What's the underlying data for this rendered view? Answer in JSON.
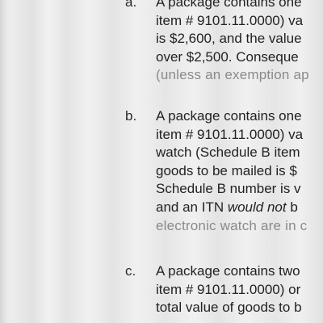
{
  "document": {
    "items": [
      {
        "marker": "a.",
        "lines": [
          "A package contains one",
          "item # 9101.11.0000) va",
          "is $2,600, and the value",
          "over $2,500. Conseque",
          "(unless an exemption ap"
        ]
      },
      {
        "marker": "b.",
        "lines": [
          "A package contains one",
          "item # 9101.11.0000) va",
          "watch (Schedule B item",
          "goods to be mailed is $",
          "Schedule B number is v"
        ],
        "itn_line": {
          "before": "and an ITN ",
          "emphasis": "would not",
          "after": " b"
        },
        "last_line": "electronic watch are in c"
      },
      {
        "marker": "c.",
        "lines": [
          "A package contains two",
          "item # 9101.11.0000) or",
          "total value of goods to b"
        ]
      }
    ]
  }
}
